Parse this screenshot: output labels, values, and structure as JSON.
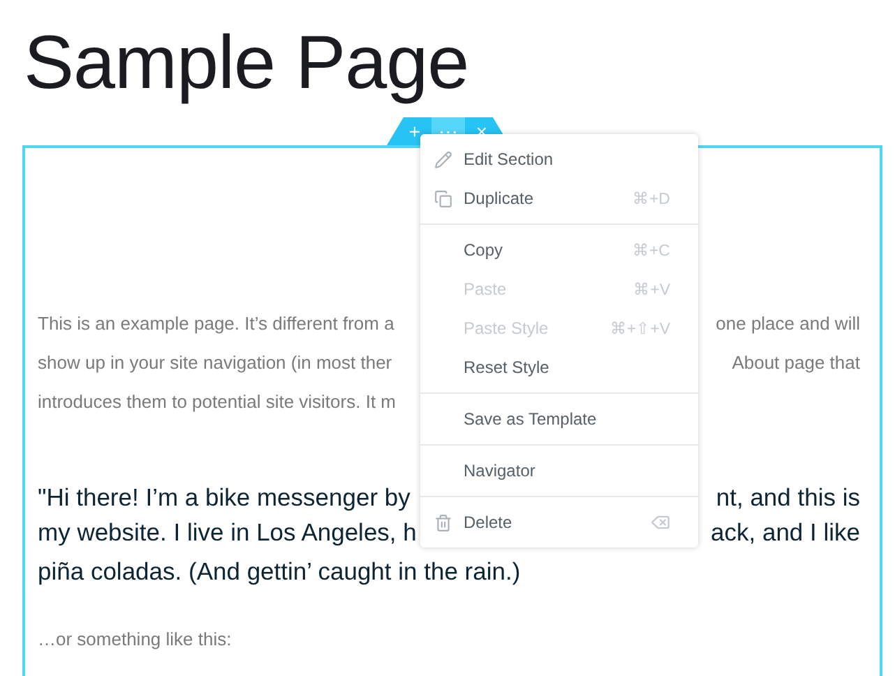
{
  "page_title": "Sample Page",
  "section_toolbar": {
    "add": "+",
    "menu": "⋯",
    "close": "×"
  },
  "paragraph_lines": [
    {
      "left": "This is an example page. It’s different from a",
      "right": "one place and will"
    },
    {
      "left": "show up in your site navigation (in most ther",
      "right": "About page that"
    },
    {
      "left": "introduces them to potential site visitors. It m"
    }
  ],
  "quote_lines": [
    {
      "left": "\"Hi there! I’m a bike messenger by",
      "right": "nt, and this is"
    },
    {
      "left": "my website. I live in Los Angeles, h",
      "right": "ack, and I like"
    },
    {
      "left": "piña coladas. (And gettin’ caught in the rain.)"
    }
  ],
  "closing_text": "…or something like this:",
  "context_menu": [
    [
      {
        "kind": "edit",
        "label": "Edit Section",
        "disabled": false
      },
      {
        "kind": "duplicate",
        "label": "Duplicate",
        "shortcut": "⌘+D",
        "disabled": false
      }
    ],
    [
      {
        "label": "Copy",
        "shortcut": "⌘+C",
        "disabled": false
      },
      {
        "label": "Paste",
        "shortcut": "⌘+V",
        "disabled": true
      },
      {
        "label": "Paste Style",
        "shortcut": "⌘+⇧+V",
        "disabled": true
      },
      {
        "label": "Reset Style",
        "disabled": false
      }
    ],
    [
      {
        "label": "Save as Template",
        "disabled": false
      }
    ],
    [
      {
        "label": "Navigator",
        "disabled": false
      }
    ],
    [
      {
        "kind": "delete",
        "label": "Delete",
        "disabled": false
      }
    ]
  ]
}
